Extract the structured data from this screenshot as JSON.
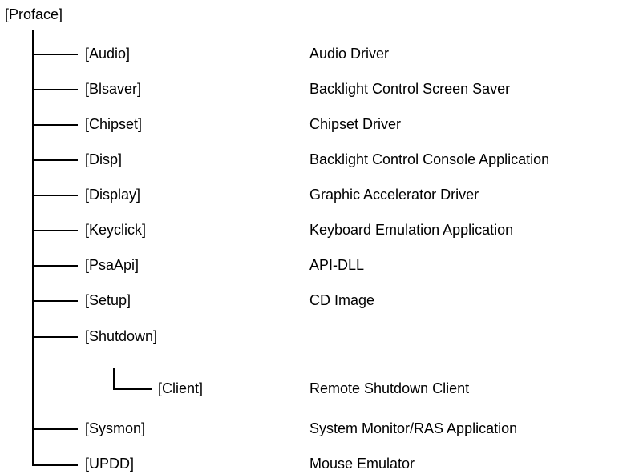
{
  "tree": {
    "root": "[Proface]",
    "items": [
      {
        "folder": "[Audio]",
        "description": "Audio Driver"
      },
      {
        "folder": "[Blsaver]",
        "description": "Backlight Control Screen Saver"
      },
      {
        "folder": "[Chipset]",
        "description": "Chipset Driver"
      },
      {
        "folder": "[Disp]",
        "description": "Backlight Control Console Application"
      },
      {
        "folder": "[Display]",
        "description": "Graphic Accelerator Driver"
      },
      {
        "folder": "[Keyclick]",
        "description": "Keyboard Emulation Application"
      },
      {
        "folder": "[PsaApi]",
        "description": "API-DLL"
      },
      {
        "folder": "[Setup]",
        "description": "CD Image"
      },
      {
        "folder": "[Shutdown]",
        "description": ""
      },
      {
        "folder": "[Sysmon]",
        "description": "System Monitor/RAS Application"
      },
      {
        "folder": "[UPDD]",
        "description": "Mouse Emulator"
      }
    ],
    "sub_item": {
      "folder": "[Client]",
      "description": "Remote Shutdown Client"
    }
  }
}
